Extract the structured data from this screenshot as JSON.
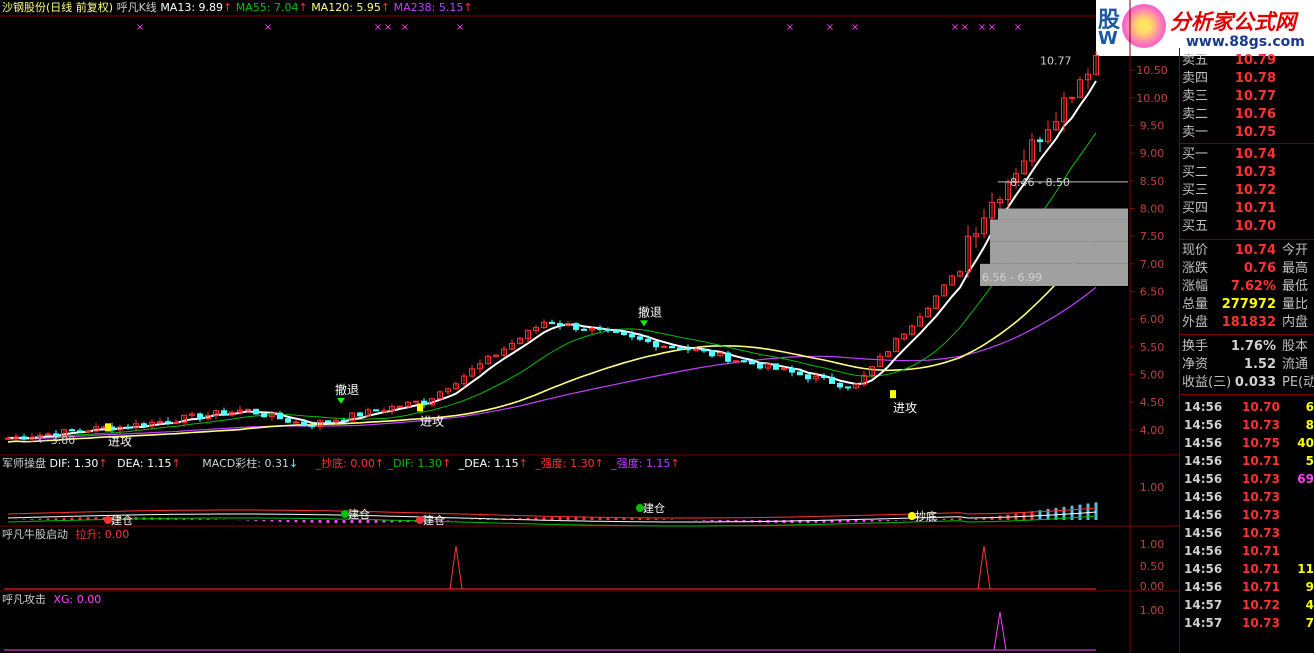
{
  "header": {
    "title": "沙钢股份(日线 前复权)",
    "indicator": "呼凡K线",
    "ma13": "MA13: 9.89",
    "ma55": "MA55: 7.04",
    "ma120": "MA120: 5.95",
    "ma238": "MA238: 5.15",
    "up_arrow": "↑"
  },
  "logo": {
    "brand": "分析家公式网",
    "url": "www.88gs.com",
    "left_text": "股",
    "left_sub": "W"
  },
  "colors": {
    "up": "#ff3232",
    "down": "#54ffff",
    "ma13": "#ffffff",
    "ma55": "#00c000",
    "ma120": "#ffff80",
    "ma238": "#c040ff",
    "axis": "#800000",
    "yellow": "#ffff00",
    "gray": "#a0a0a0"
  },
  "price_axis": [
    "10.50",
    "10.00",
    "9.50",
    "9.00",
    "8.50",
    "8.00",
    "7.50",
    "7.00",
    "6.50",
    "6.00",
    "5.50",
    "5.00",
    "4.50",
    "4.00"
  ],
  "annotations": {
    "high_label": "10.77",
    "low_label": "3.80",
    "range1": "8.46 - 8.50",
    "range2": "6.56 - 6.99",
    "retreat": "撤退",
    "attack": "进攻"
  },
  "macd_panel": {
    "name": "军师操盘",
    "dif": "DIF: 1.30",
    "dea": "DEA: 1.15",
    "macd": "MACD彩柱: 0.31",
    "down_arrow": "↓",
    "chaodi": "_抄底: 0.00",
    "dif2": "_DIF: 1.30",
    "dea2": "_DEA: 1.15",
    "qiangdu1": "_强度: 1.30",
    "qiangdu2": "_强度: 1.15",
    "axis": "1.00",
    "labels": [
      "建仓",
      "建仓",
      "建仓",
      "建仓",
      "抄底"
    ]
  },
  "panel2": {
    "name": "呼凡牛股启动",
    "item": "拉升: 0.00",
    "axis": [
      "1.00",
      "0.50",
      "0.00"
    ]
  },
  "panel3": {
    "name": "呼凡攻击",
    "item": "XG: 0.00",
    "axis": "1.00"
  },
  "quote": {
    "asks": [
      {
        "label": "卖五",
        "price": "10.79"
      },
      {
        "label": "卖四",
        "price": "10.78"
      },
      {
        "label": "卖三",
        "price": "10.77"
      },
      {
        "label": "卖二",
        "price": "10.76"
      },
      {
        "label": "卖一",
        "price": "10.75"
      }
    ],
    "bids": [
      {
        "label": "买一",
        "price": "10.74"
      },
      {
        "label": "买二",
        "price": "10.73"
      },
      {
        "label": "买三",
        "price": "10.72"
      },
      {
        "label": "买四",
        "price": "10.71"
      },
      {
        "label": "买五",
        "price": "10.70"
      }
    ],
    "stats": [
      {
        "label": "现价",
        "value": "10.74",
        "ext": "今开",
        "color": "#ff3232"
      },
      {
        "label": "涨跌",
        "value": "0.76",
        "ext": "最高",
        "color": "#ff3232"
      },
      {
        "label": "涨幅",
        "value": "7.62%",
        "ext": "最低",
        "color": "#ff3232"
      },
      {
        "label": "总量",
        "value": "277972",
        "ext": "量比",
        "color": "#ffff00"
      },
      {
        "label": "外盘",
        "value": "181832",
        "ext": "内盘",
        "color": "#ff3232"
      },
      {
        "label": "换手",
        "value": "1.76%",
        "ext": "股本",
        "color": "#d0d0d0"
      },
      {
        "label": "净资",
        "value": "1.52",
        "ext": "流通",
        "color": "#d0d0d0"
      },
      {
        "label": "收益(三)",
        "value": "0.033",
        "ext": "PE(动",
        "color": "#d0d0d0"
      }
    ],
    "ticks": [
      {
        "time": "14:56",
        "price": "10.70",
        "vol": "6",
        "pc": "#ff3232",
        "vc": "#ffff00"
      },
      {
        "time": "14:56",
        "price": "10.73",
        "vol": "8",
        "pc": "#ff3232",
        "vc": "#ffff00"
      },
      {
        "time": "14:56",
        "price": "10.75",
        "vol": "40",
        "pc": "#ff3232",
        "vc": "#ffff00"
      },
      {
        "time": "14:56",
        "price": "10.71",
        "vol": "5",
        "pc": "#ff3232",
        "vc": "#ffff00"
      },
      {
        "time": "14:56",
        "price": "10.73",
        "vol": "69",
        "pc": "#ff3232",
        "vc": "#ff40ff"
      },
      {
        "time": "14:56",
        "price": "10.73",
        "vol": "",
        "pc": "#ff3232",
        "vc": "#ffff00"
      },
      {
        "time": "14:56",
        "price": "10.73",
        "vol": "",
        "pc": "#ff3232",
        "vc": "#ffff00"
      },
      {
        "time": "14:56",
        "price": "10.73",
        "vol": "",
        "pc": "#ff3232",
        "vc": "#ffff00"
      },
      {
        "time": "14:56",
        "price": "10.71",
        "vol": "",
        "pc": "#ff3232",
        "vc": "#ffff00"
      },
      {
        "time": "14:56",
        "price": "10.71",
        "vol": "11",
        "pc": "#ff3232",
        "vc": "#ffff00"
      },
      {
        "time": "14:56",
        "price": "10.71",
        "vol": "9",
        "pc": "#ff3232",
        "vc": "#ffff00"
      },
      {
        "time": "14:57",
        "price": "10.72",
        "vol": "4",
        "pc": "#ff3232",
        "vc": "#ffff00"
      },
      {
        "time": "14:57",
        "price": "10.73",
        "vol": "7",
        "pc": "#ff3232",
        "vc": "#ffff00"
      }
    ]
  },
  "chart_data": {
    "type": "candlestick",
    "ylim": [
      3.6,
      10.9
    ],
    "segments": [
      {
        "from": 3.85,
        "to": 4.05,
        "bars": 14,
        "trend": "flat"
      },
      {
        "from": 4.05,
        "to": 4.35,
        "bars": 16,
        "trend": "up"
      },
      {
        "from": 4.35,
        "to": 4.1,
        "bars": 8,
        "trend": "down"
      },
      {
        "from": 4.1,
        "to": 4.5,
        "bars": 14,
        "trend": "up"
      },
      {
        "from": 4.5,
        "to": 5.95,
        "bars": 16,
        "trend": "up"
      },
      {
        "from": 5.95,
        "to": 5.5,
        "bars": 16,
        "trend": "down"
      },
      {
        "from": 5.5,
        "to": 4.8,
        "bars": 22,
        "trend": "down"
      },
      {
        "from": 4.8,
        "to": 6.9,
        "bars": 14,
        "trend": "up"
      },
      {
        "from": 7.5,
        "to": 10.77,
        "bars": 17,
        "trend": "up"
      }
    ],
    "last_close": 10.74,
    "high": 10.77,
    "low": 3.8
  }
}
